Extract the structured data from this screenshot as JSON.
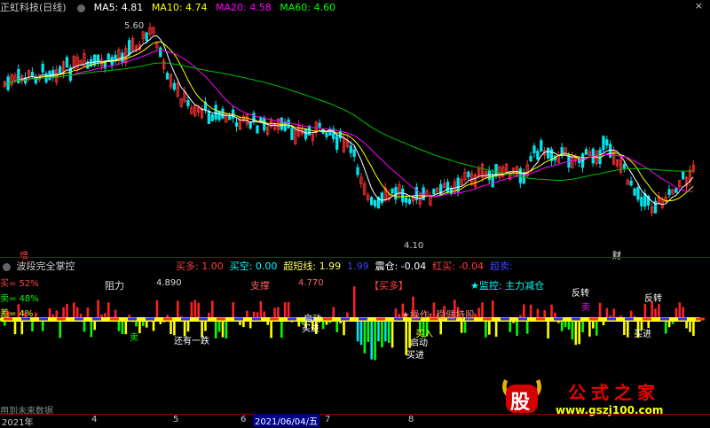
{
  "header": {
    "stock_name": "正虹科技(日线)",
    "ma5_label": "MA5: 4.81",
    "ma10_label": "MA10: 4.74",
    "ma20_label": "MA20: 4.58",
    "ma60_label": "MA60: 4.60",
    "close_button": "×",
    "colors": {
      "ma5": "#ffffff",
      "ma10": "#ffff00",
      "ma20": "#ff00ff",
      "ma60": "#00ff00"
    }
  },
  "main_chart": {
    "high_label": "5.60",
    "low_label": "4.10",
    "marker_left": "增",
    "marker_right": "财"
  },
  "sub_panel": {
    "title": "波段完全掌控",
    "stats": [
      {
        "label": "买多: 1.00",
        "color": "#ff4040"
      },
      {
        "label": "买空: 0.00",
        "color": "#00ffff"
      },
      {
        "label": "超短线: 1.99",
        "color": "#ffff66"
      },
      {
        "label": "1.99",
        "color": "#4040ff"
      },
      {
        "label": "震仓: -0.04",
        "color": "#ffffff"
      },
      {
        "label": "红买: -0.04",
        "color": "#ff4040"
      },
      {
        "label": "超卖:",
        "color": "#4040ff"
      }
    ],
    "buy_pct": "买= 52%",
    "sell_pct": "卖= 48%",
    "diff_pct": "差= 4%",
    "resistance_label": "阻力",
    "resistance_value": "4.890",
    "support_label": "支撑",
    "support_value": "4.770",
    "signal": "【买多】",
    "monitor": "★监控: 主力减仓",
    "operation": "★操作: 稳健持股",
    "annotations": {
      "reverse1": "反转",
      "reverse2": "反转",
      "buy_in1": "买进",
      "buy_in2": "买进",
      "buy_in3": "买进",
      "sell1": "卖",
      "sell2": "卖",
      "start1": "启动",
      "start2": "启动",
      "drop": "还有一跌",
      "zero_line_bubble": "买入"
    },
    "future_data": "用到未来数据"
  },
  "x_axis": {
    "year_label": "2021年",
    "ticks": [
      "4",
      "5",
      "6",
      "7",
      "8"
    ],
    "current_date": "2021/06/04/五"
  },
  "watermark": {
    "logo_char": "股",
    "site_title": "公式之家",
    "url": "www.gszj100.com"
  }
}
